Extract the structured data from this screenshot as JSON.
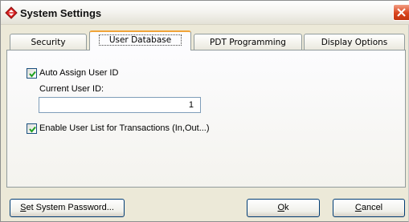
{
  "window": {
    "title": "System Settings"
  },
  "tabs": [
    {
      "label": "Security",
      "active": false
    },
    {
      "label": "User Database",
      "active": true
    },
    {
      "label": "PDT Programming",
      "active": false
    },
    {
      "label": "Display Options",
      "active": false
    }
  ],
  "user_database": {
    "auto_assign": {
      "label": "Auto Assign User ID",
      "checked": true
    },
    "current_user_id": {
      "label": "Current User ID:",
      "value": "1"
    },
    "enable_user_list": {
      "label": "Enable User List for Transactions (In,Out...)",
      "checked": true
    }
  },
  "buttons": {
    "set_password": {
      "mnemonic": "S",
      "rest": "et System Password..."
    },
    "ok": {
      "mnemonic": "O",
      "rest": "k"
    },
    "cancel": {
      "mnemonic": "C",
      "rest": "ancel"
    }
  },
  "icons": {
    "app": "diamond-app-icon",
    "close": "close-icon",
    "check": "checkmark-icon"
  },
  "colors": {
    "active_tab_accent": "#f1a438",
    "close_button": "#d9441e",
    "checkmark": "#21a121"
  }
}
